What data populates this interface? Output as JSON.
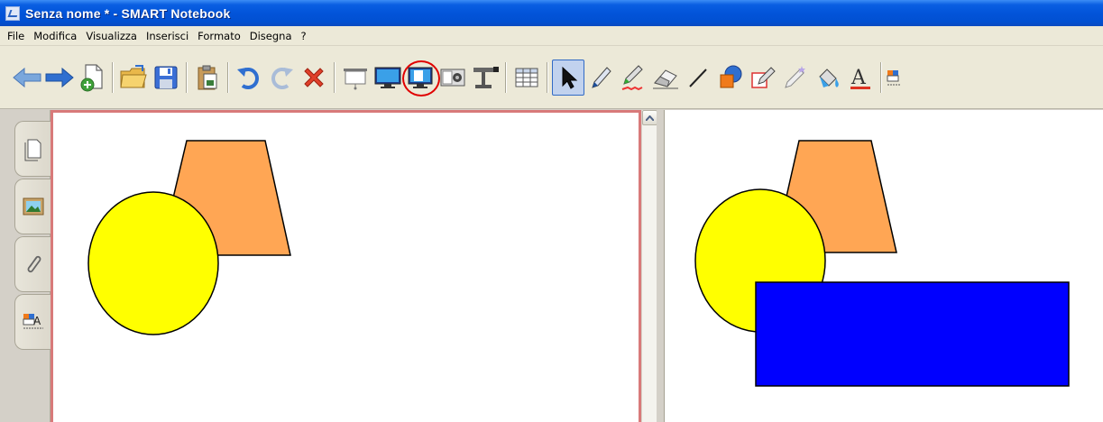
{
  "window": {
    "title": "Senza nome * - SMART Notebook"
  },
  "menu": {
    "items": [
      "File",
      "Modifica",
      "Visualizza",
      "Inserisci",
      "Formato",
      "Disegna",
      "?"
    ]
  },
  "toolbar": {
    "buttons": [
      "back-icon",
      "forward-icon",
      "add-page-icon",
      "open-file-icon",
      "save-icon",
      "paste-icon",
      "undo-icon",
      "redo-icon",
      "delete-icon",
      "screen-shade-icon",
      "full-screen-icon",
      "dual-page-icon",
      "capture-icon",
      "document-camera-icon",
      "table-icon",
      "select-icon",
      "pen-icon",
      "creative-pen-icon",
      "eraser-icon",
      "line-icon",
      "shapes-icon",
      "shape-recognition-pen-icon",
      "magic-pen-icon",
      "fill-icon",
      "text-icon",
      "properties-icon"
    ],
    "active": "select-icon",
    "highlighted": "dual-page-icon"
  },
  "sidebar": {
    "tabs": [
      "page-sorter-icon",
      "gallery-icon",
      "attachments-icon",
      "properties-icon"
    ]
  },
  "colors": {
    "titlebar": "#0254d9",
    "circle_fill": "#ffff00",
    "trapezoid_fill": "#ffa654",
    "rectangle_fill": "#0000ff",
    "page_border": "#d87a7a"
  }
}
